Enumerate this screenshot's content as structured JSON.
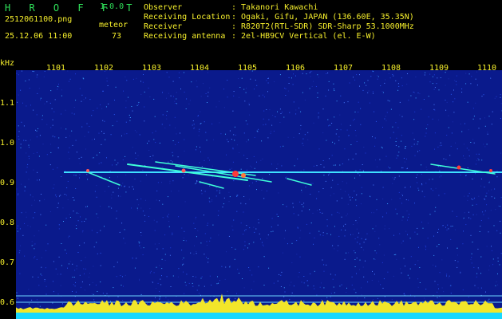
{
  "header": {
    "app_title": "H R O F F T",
    "version": "1.0.0",
    "filename": "2512061100.png",
    "datetime": "25.12.06 11:00",
    "meteor_label": "meteor",
    "meteor_count": "73"
  },
  "info": [
    {
      "key": "Observer",
      "value": ": Takanori Kawachi"
    },
    {
      "key": "Receiving Location",
      "value": ": Ogaki, Gifu, JAPAN (136.60E, 35.35N)"
    },
    {
      "key": "Receiver",
      "value": ": R820T2(RTL-SDR) SDR-Sharp 53.1000MHz"
    },
    {
      "key": "Receiving antenna",
      "value": ": 2el-HB9CV Vertical (el. E-W)"
    }
  ],
  "axis": {
    "y_unit": "kHz",
    "x_ticks": [
      "1101",
      "1102",
      "1103",
      "1104",
      "1105",
      "1106",
      "1107",
      "1108",
      "1109",
      "1110"
    ],
    "y_ticks": [
      "1.1",
      "1.0",
      "0.9",
      "0.8",
      "0.7",
      "0.6"
    ]
  },
  "colors": {
    "background": "#0a1a8c",
    "header_text": "#2fe15a",
    "axis_text": "#f6ef2c",
    "carrier": "#3fe0ff",
    "echo_hot": "#ff3a3a"
  }
}
